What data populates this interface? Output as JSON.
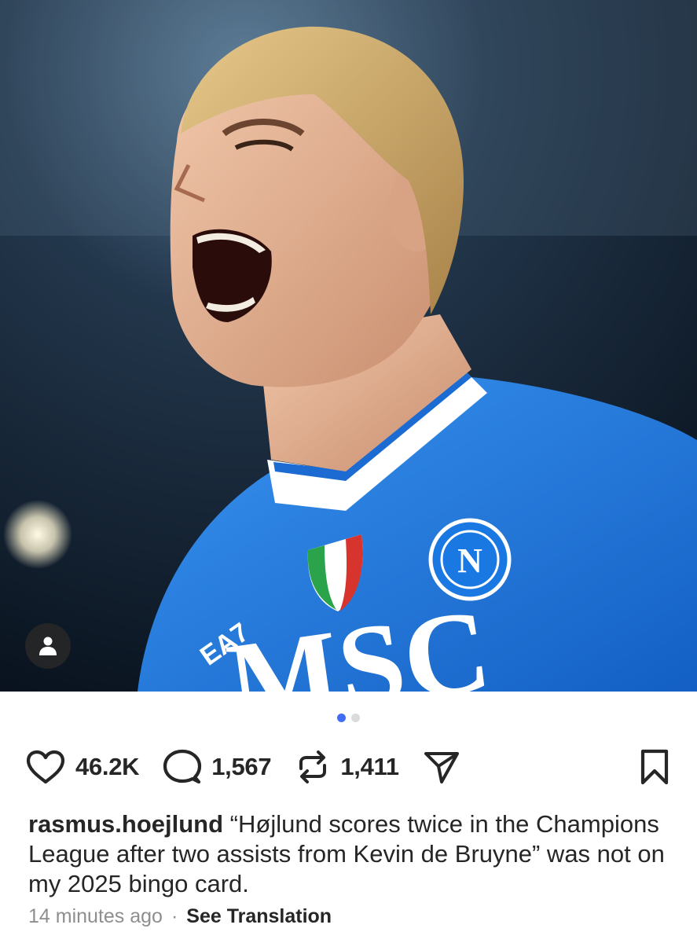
{
  "post": {
    "image_alt": "",
    "carousel": {
      "count": 2,
      "active_index": 0
    },
    "actions": {
      "likes": "46.2K",
      "comments": "1,567",
      "reposts": "1,411"
    },
    "caption": {
      "username": "rasmus.hoejlund",
      "text": "“Højlund scores twice in the Champions League after two assists from Kevin de Bruyne” was not on my 2025 bingo card."
    },
    "meta": {
      "timestamp": "14 minutes ago",
      "separator": "·",
      "translate_label": "See Translation"
    },
    "jersey_text": "MSC",
    "icons": {
      "like": "heart-icon",
      "comment": "comment-bubble-icon",
      "repost": "repost-icon",
      "share": "send-icon",
      "save": "bookmark-icon",
      "tag": "user-tag-icon"
    },
    "colors": {
      "jersey_blue": "#1e7be0",
      "carousel_active": "#3f6df6",
      "carousel_inactive": "#dbdbdb",
      "secondary_text": "#8e8e8e"
    }
  }
}
